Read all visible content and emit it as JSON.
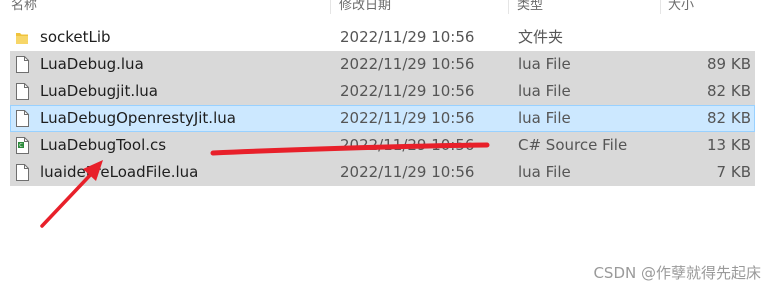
{
  "columns": {
    "name": "名称",
    "date": "修改日期",
    "type": "类型",
    "size": "大小"
  },
  "files": [
    {
      "name": "socketLib",
      "date": "2022/11/29 10:56",
      "type": "文件夹",
      "size": "",
      "icon": "folder-icon",
      "state": "normal"
    },
    {
      "name": "LuaDebug.lua",
      "date": "2022/11/29 10:56",
      "type": "lua File",
      "size": "89 KB",
      "icon": "file-icon",
      "state": "highlight"
    },
    {
      "name": "LuaDebugjit.lua",
      "date": "2022/11/29 10:56",
      "type": "lua File",
      "size": "82 KB",
      "icon": "file-icon",
      "state": "highlight"
    },
    {
      "name": "LuaDebugOpenrestyJit.lua",
      "date": "2022/11/29 10:56",
      "type": "lua File",
      "size": "82 KB",
      "icon": "file-icon",
      "state": "selected"
    },
    {
      "name": "LuaDebugTool.cs",
      "date": "2022/11/29 10:56",
      "type": "C# Source File",
      "size": "13 KB",
      "icon": "csharp-file-icon",
      "state": "highlight"
    },
    {
      "name": "luaidePreLoadFile.lua",
      "date": "2022/11/29 10:56",
      "type": "lua File",
      "size": "7 KB",
      "icon": "file-icon",
      "state": "highlight"
    }
  ],
  "watermark": "CSDN @作孽就得先起床",
  "colors": {
    "highlight": "#d9d9d9",
    "selected": "#cce8ff",
    "selected_border": "#99d1ff",
    "annotation": "#e8202a",
    "folder": "#f0c33c"
  }
}
